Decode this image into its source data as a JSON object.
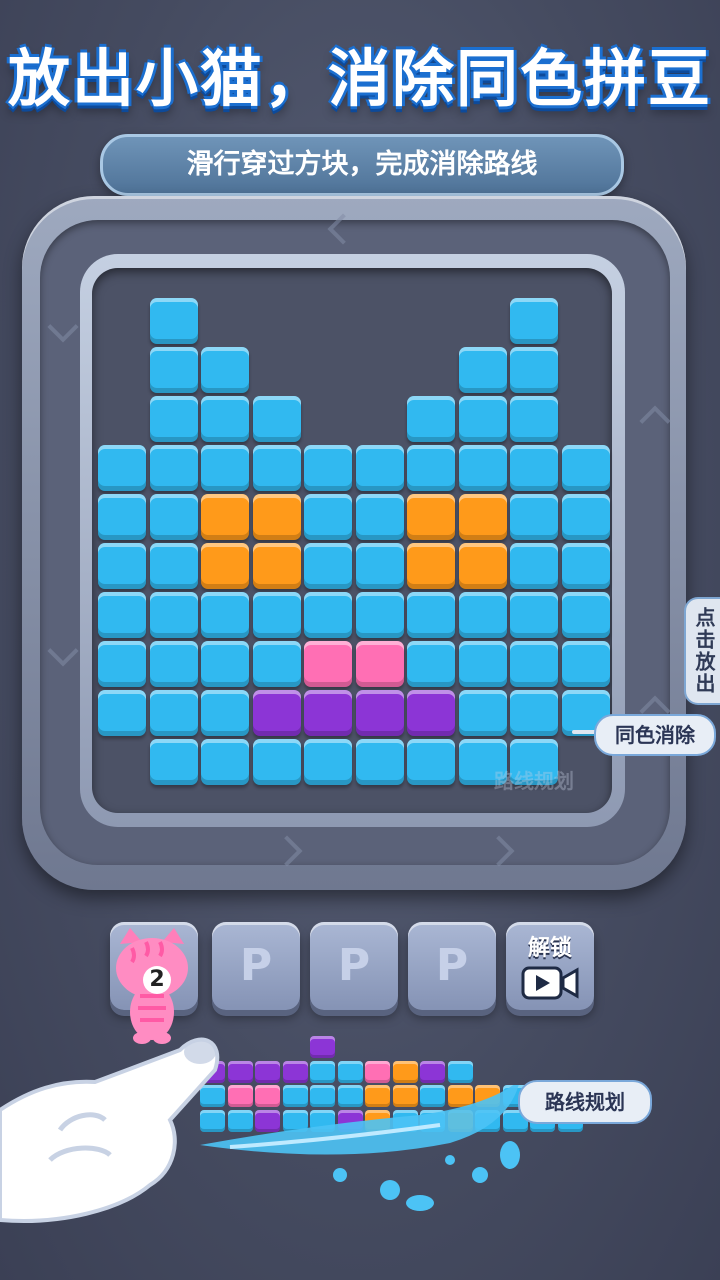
{
  "header": {
    "title": "放出小猫，消除同色拼豆",
    "subtitle": "滑行穿过方块，完成消除路线"
  },
  "board": {
    "watermark": "路线规划",
    "colors": {
      "cyan": "#31b9f0",
      "orange": "#ff9a1a",
      "pink": "#ff6fb4",
      "purple": "#8c35d6"
    },
    "grid": [
      ". C . . . . . . C .",
      ". C C . . . . C C .",
      ". C C C . . C C C .",
      "C C C C C C C C C C",
      "C C O O C C O O C C",
      "C C O O C C O O C C",
      "C C C C C C C C C C",
      "C C C C P P C C C C",
      "C C C U U U U C C C",
      ". C C C C C C C C ."
    ]
  },
  "side_tab": {
    "label": "点击放出"
  },
  "callouts": {
    "same_color": "同色消除",
    "route_plan": "路线规划"
  },
  "slots": {
    "cat_count": "2",
    "locked_label": "P",
    "unlock_label": "解锁",
    "video_icon": "video-camera-icon"
  }
}
